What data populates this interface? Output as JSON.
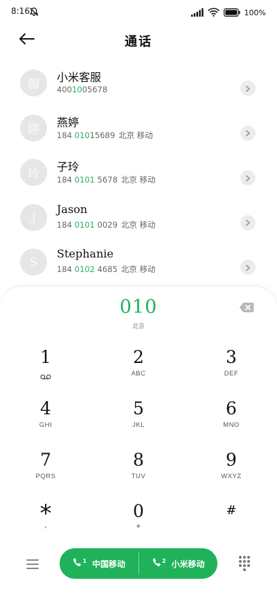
{
  "status_bar": {
    "time": "8:16",
    "battery": "100%"
  },
  "header": {
    "title": "通话"
  },
  "contacts": [
    {
      "avatar_char": "服",
      "name": "小米客服",
      "number_pre": "400",
      "number_hl": "10",
      "number_post": "05678",
      "location": ""
    },
    {
      "avatar_char": "婷",
      "name": "燕婷",
      "number_pre": "184 ",
      "number_hl": "010",
      "number_post": "15689",
      "location": "北京 移动"
    },
    {
      "avatar_char": "玲",
      "name": "子玲",
      "number_pre": "184 ",
      "number_hl": "0101",
      "number_post": " 5678",
      "location": "北京 移动"
    },
    {
      "avatar_char": "J",
      "name": "Jason",
      "number_pre": "184 ",
      "number_hl": "0101",
      "number_post": " 0029",
      "location": "北京 移动"
    },
    {
      "avatar_char": "S",
      "name": "Stephanie",
      "number_pre": "184 ",
      "number_hl": "0102",
      "number_post": " 4685",
      "location": "北京 移动"
    }
  ],
  "dialer": {
    "number": "010",
    "location": "北京",
    "keys": [
      {
        "digit": "1",
        "letters": ""
      },
      {
        "digit": "2",
        "letters": "ABC"
      },
      {
        "digit": "3",
        "letters": "DEF"
      },
      {
        "digit": "4",
        "letters": "GHI"
      },
      {
        "digit": "5",
        "letters": "JKL"
      },
      {
        "digit": "6",
        "letters": "MNO"
      },
      {
        "digit": "7",
        "letters": "PQRS"
      },
      {
        "digit": "8",
        "letters": "TUV"
      },
      {
        "digit": "9",
        "letters": "WXYZ"
      },
      {
        "digit": "*",
        "letters": ","
      },
      {
        "digit": "0",
        "letters": "+"
      },
      {
        "digit": "#",
        "letters": ""
      }
    ]
  },
  "call_buttons": {
    "sim1_label": "中国移动",
    "sim1_index": "1",
    "sim2_label": "小米移动",
    "sim2_index": "2"
  },
  "colors": {
    "accent": "#1fb25a",
    "avatar_bg": "#e6e6e6"
  },
  "icons": [
    "bell-off-icon",
    "signal-icon",
    "wifi-icon",
    "battery-icon",
    "back-arrow-icon",
    "chevron-right-icon",
    "backspace-icon",
    "voicemail-icon",
    "menu-icon",
    "phone-icon",
    "dialpad-icon"
  ]
}
